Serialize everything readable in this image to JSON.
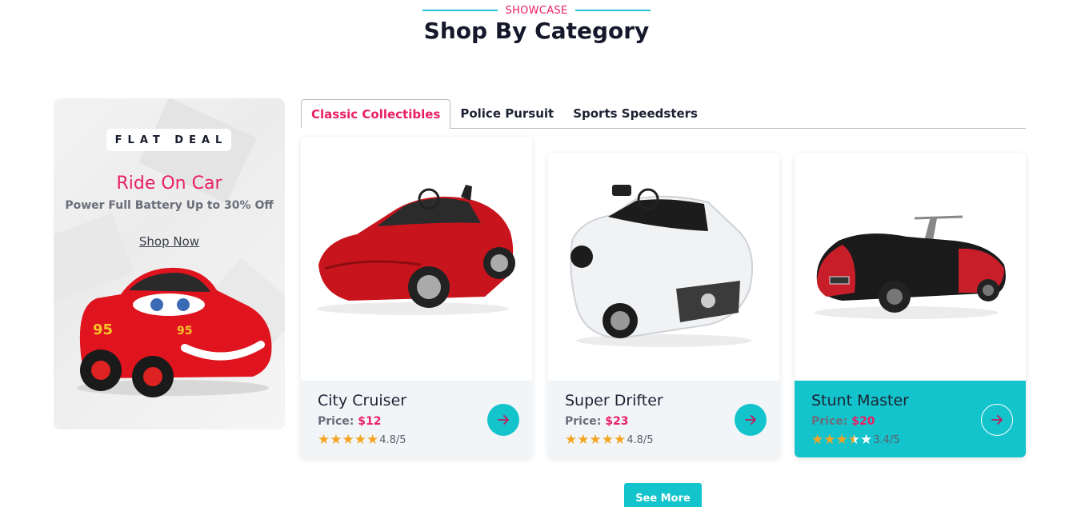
{
  "header": {
    "eyebrow": "SHOWCASE",
    "title": "Shop By Category"
  },
  "promo": {
    "badge": "FLAT DEAL",
    "title": "Ride On Car",
    "subtitle": "Power Full Battery Up to 30% Off",
    "link": "Shop Now"
  },
  "tabs": [
    {
      "label": "Classic Collectibles",
      "active": true
    },
    {
      "label": "Police Pursuit",
      "active": false
    },
    {
      "label": "Sports Speedsters",
      "active": false
    }
  ],
  "products": [
    {
      "name": "City Cruiser",
      "price_label": "Price:",
      "price": "$12",
      "rating_text": "4.8/5",
      "rating": 4.8,
      "car_color": "#c8141c"
    },
    {
      "name": "Super Drifter",
      "price_label": "Price:",
      "price": "$23",
      "rating_text": "4.8/5",
      "rating": 4.8,
      "car_color": "#e9ecef"
    },
    {
      "name": "Stunt Master",
      "price_label": "Price:",
      "price": "$20",
      "rating_text": "3.4/5",
      "rating": 3.4,
      "car_color": "#c81e2a"
    }
  ],
  "see_more": "See More",
  "colors": {
    "accent_pink": "#ea1f63",
    "accent_teal": "#14c4cc",
    "star": "#f4a521"
  }
}
